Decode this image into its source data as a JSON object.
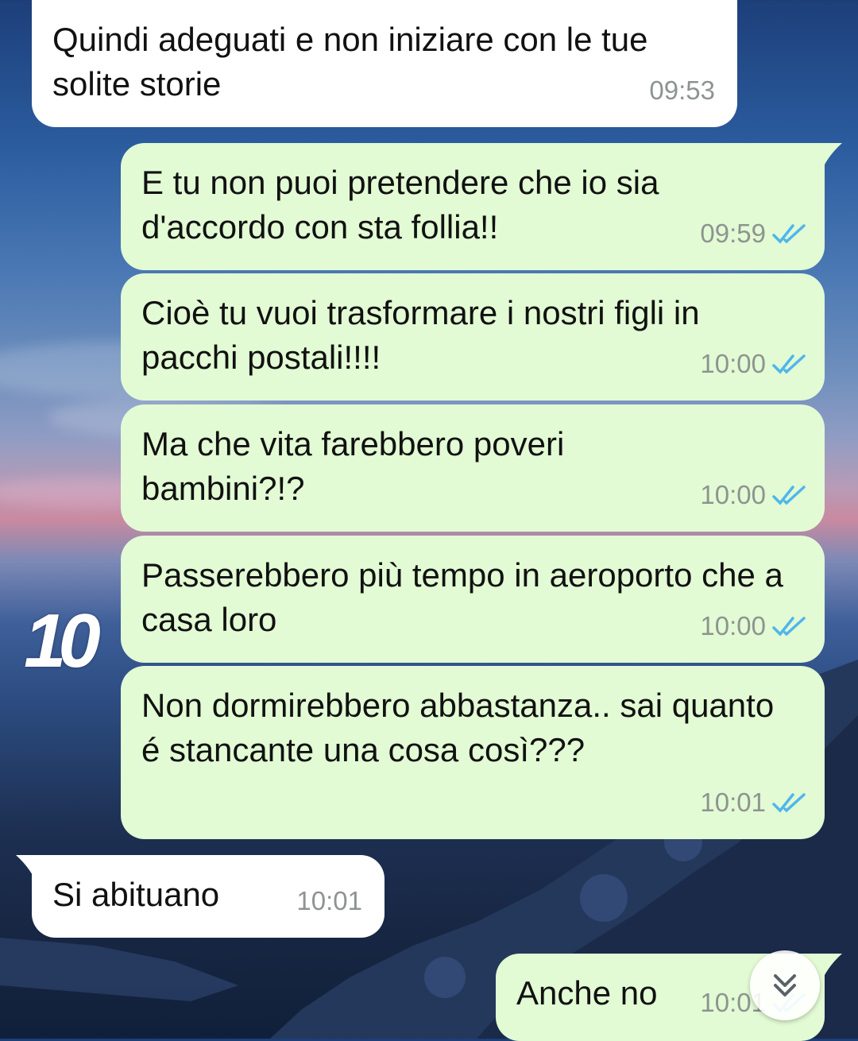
{
  "messages": [
    {
      "text": "Quindi adeguati e non iniziare con le tue solite storie",
      "time": "09:53",
      "direction": "incoming"
    },
    {
      "text": "E tu non puoi pretendere che io sia d'accordo con sta follia!!",
      "time": "09:59",
      "direction": "outgoing",
      "status": "read"
    },
    {
      "text": "Cioè tu vuoi trasformare i nostri figli in pacchi postali!!!!",
      "time": "10:00",
      "direction": "outgoing",
      "status": "read"
    },
    {
      "text": "Ma che vita farebbero poveri bambini?!?",
      "time": "10:00",
      "direction": "outgoing",
      "status": "read"
    },
    {
      "text": "Passerebbero più tempo in aeroporto che a casa loro",
      "time": "10:00",
      "direction": "outgoing",
      "status": "read"
    },
    {
      "text": "Non dormirebbero abbastanza.. sai quanto é stancante una cosa così???",
      "time": "10:01",
      "direction": "outgoing",
      "status": "read"
    },
    {
      "text": "Si abituano",
      "time": "10:01",
      "direction": "incoming"
    },
    {
      "text": "Anche no",
      "time": "10:01",
      "direction": "outgoing",
      "status": "read"
    }
  ],
  "overlay_marker": "10",
  "icons": {
    "read_ticks": "double-check-icon",
    "scroll_down": "double-chevron-down-icon"
  },
  "colors": {
    "incoming_bubble": "#ffffff",
    "outgoing_bubble": "#e2fbd4",
    "read_tick": "#4fb6ec",
    "timestamp": "#8e9490"
  }
}
